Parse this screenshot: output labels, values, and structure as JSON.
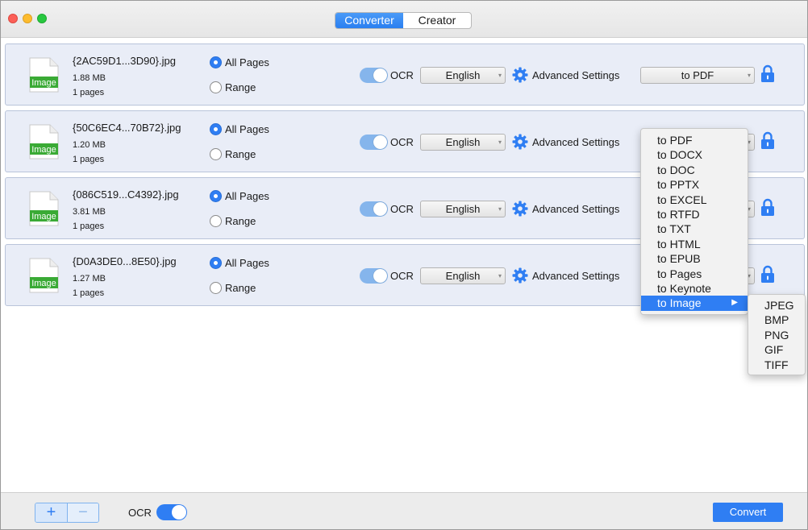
{
  "tabs": [
    {
      "label": "Converter",
      "active": true
    },
    {
      "label": "Creator",
      "active": false
    }
  ],
  "files": [
    {
      "name": "{2AC59D1...3D90}.jpg",
      "size": "1.88 MB",
      "pages": "1 pages",
      "icon_label": "Image",
      "page_mode": "All Pages",
      "all_pages_label": "All Pages",
      "range_label": "Range",
      "ocr_label": "OCR",
      "ocr_enabled": true,
      "language": "English",
      "advanced_label": "Advanced Settings",
      "format": "to PDF"
    },
    {
      "name": "{50C6EC4...70B72}.jpg",
      "size": "1.20 MB",
      "pages": "1 pages",
      "icon_label": "Image",
      "page_mode": "All Pages",
      "all_pages_label": "All Pages",
      "range_label": "Range",
      "ocr_label": "OCR",
      "ocr_enabled": true,
      "language": "English",
      "advanced_label": "Advanced Settings",
      "format": ""
    },
    {
      "name": "{086C519...C4392}.jpg",
      "size": "3.81 MB",
      "pages": "1 pages",
      "icon_label": "Image",
      "page_mode": "All Pages",
      "all_pages_label": "All Pages",
      "range_label": "Range",
      "ocr_label": "OCR",
      "ocr_enabled": true,
      "language": "English",
      "advanced_label": "Advanced Settings",
      "format": ""
    },
    {
      "name": "{D0A3DE0...8E50}.jpg",
      "size": "1.27 MB",
      "pages": "1 pages",
      "icon_label": "Image",
      "page_mode": "All Pages",
      "all_pages_label": "All Pages",
      "range_label": "Range",
      "ocr_label": "OCR",
      "ocr_enabled": true,
      "language": "English",
      "advanced_label": "Advanced Settings",
      "format": ""
    }
  ],
  "format_menu": {
    "items": [
      "to PDF",
      "to DOCX",
      "to DOC",
      "to PPTX",
      "to EXCEL",
      "to RTFD",
      "to TXT",
      "to HTML",
      "to EPUB",
      "to Pages",
      "to Keynote",
      "to Image"
    ],
    "highlighted": "to Image"
  },
  "image_submenu": {
    "items": [
      "JPEG",
      "BMP",
      "PNG",
      "GIF",
      "TIFF"
    ]
  },
  "bottom": {
    "add_label": "+",
    "remove_label": "−",
    "ocr_label": "OCR",
    "ocr_enabled": true,
    "convert_label": "Convert"
  },
  "colors": {
    "accent": "#2f7ef3",
    "row_background": "#e9edf7",
    "image_icon_green": "#3aaa35"
  }
}
